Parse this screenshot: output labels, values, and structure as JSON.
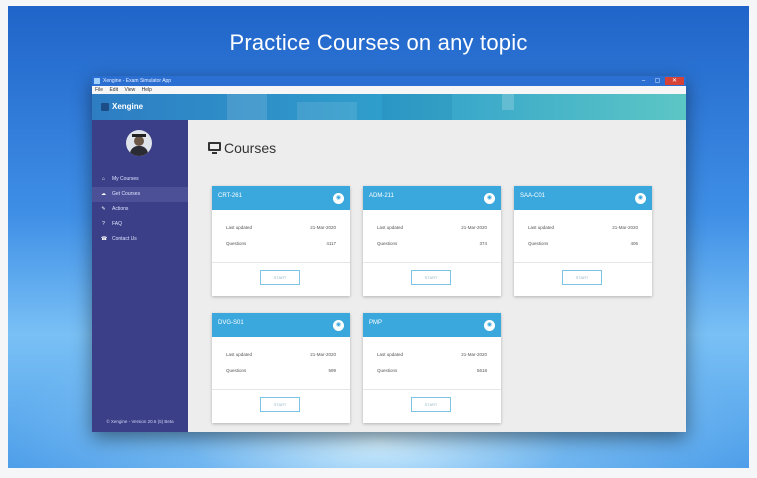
{
  "headline": "Practice Courses on any topic",
  "window": {
    "title": "Xengine - Exam Simulator App",
    "controls": {
      "minimize": "–",
      "maximize": "▢",
      "close": "✕"
    }
  },
  "menu": [
    "File",
    "Edit",
    "View",
    "Help"
  ],
  "header": {
    "brand": "Xengine"
  },
  "sidebar": {
    "items": [
      {
        "icon": "⌂",
        "label": "My Courses"
      },
      {
        "icon": "☁",
        "label": "Get Courses"
      },
      {
        "icon": "✎",
        "label": "Actions"
      },
      {
        "icon": "?",
        "label": "FAQ"
      },
      {
        "icon": "☎",
        "label": "Contact Us"
      }
    ],
    "version": "© Xengine - Version 20.6 (5) Beta"
  },
  "page": {
    "title": "Courses"
  },
  "labels": {
    "last_updated": "Last updated",
    "questions": "Questions",
    "start": "START",
    "badge": "◉"
  },
  "courses": [
    {
      "name": "CRT-261",
      "last_updated": "21-Mar-2020",
      "questions": "4117"
    },
    {
      "name": "ADM-211",
      "last_updated": "21-Mar-2020",
      "questions": "374"
    },
    {
      "name": "SAA-C01",
      "last_updated": "21-Mar-2020",
      "questions": "406"
    },
    {
      "name": "DVG-S01",
      "last_updated": "21-Mar-2020",
      "questions": "599"
    },
    {
      "name": "PMP",
      "last_updated": "21-Mar-2020",
      "questions": "5618"
    }
  ]
}
